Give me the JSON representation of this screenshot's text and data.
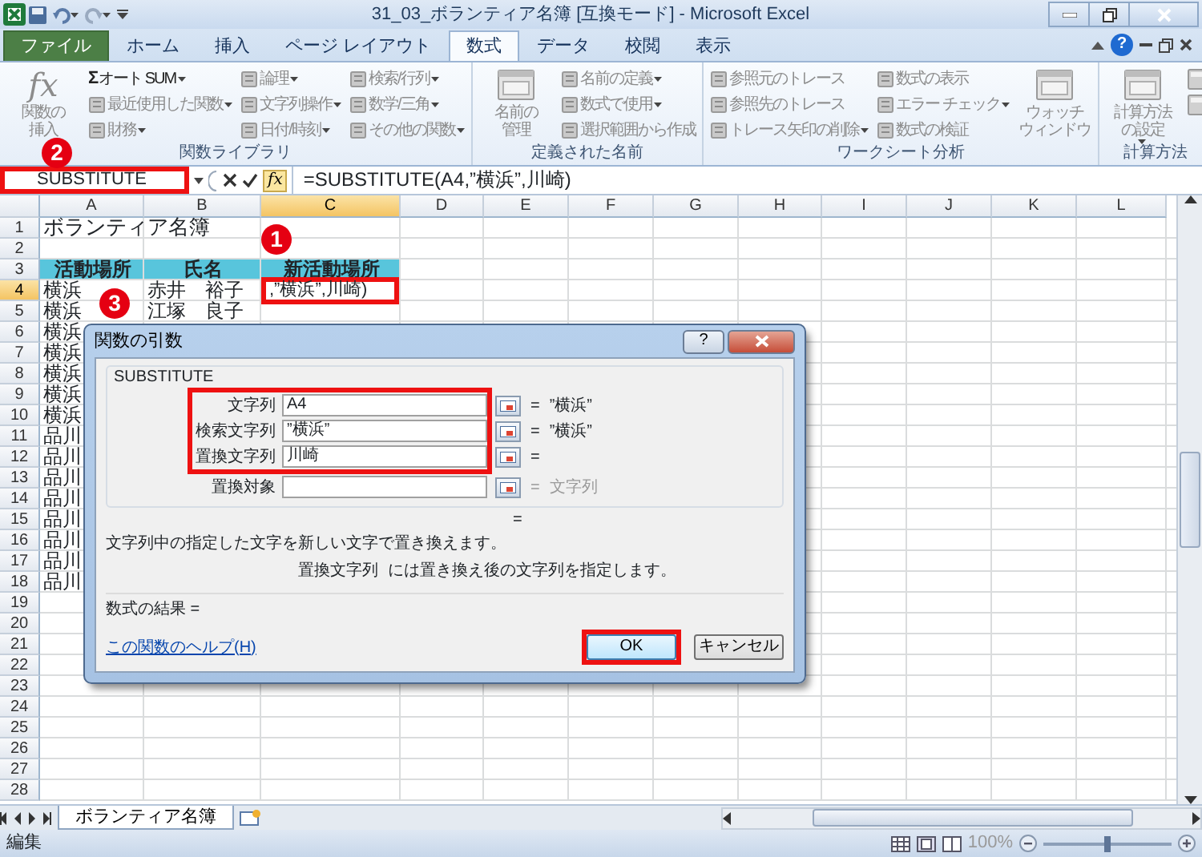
{
  "title_bar": {
    "title": "31_03_ボランティア名簿 [互換モード] - Microsoft Excel"
  },
  "ribbon_tabs": [
    {
      "label": "ファイル",
      "kind": "file",
      "selected": false
    },
    {
      "label": "ホーム",
      "kind": "tab",
      "selected": false
    },
    {
      "label": "挿入",
      "kind": "tab",
      "selected": false
    },
    {
      "label": "ページ レイアウト",
      "kind": "tab",
      "selected": false
    },
    {
      "label": "数式",
      "kind": "tab",
      "selected": true
    },
    {
      "label": "データ",
      "kind": "tab",
      "selected": false
    },
    {
      "label": "校閲",
      "kind": "tab",
      "selected": false
    },
    {
      "label": "表示",
      "kind": "tab",
      "selected": false
    }
  ],
  "ribbon_help": "?",
  "ribbon_groups": [
    {
      "label": "関数ライブラリ",
      "items": [
        {
          "kind": "large",
          "lines": [
            "関数の",
            "挿入"
          ],
          "glyph": "fx",
          "disabled": true
        },
        {
          "kind": "small",
          "label": "オート SUM",
          "glyph": "Σ",
          "dropdown": true,
          "disabled": false
        },
        {
          "kind": "small",
          "label": "最近使用した関数",
          "dropdown": true,
          "disabled": true
        },
        {
          "kind": "small",
          "label": "財務",
          "dropdown": true,
          "disabled": true
        },
        {
          "kind": "small",
          "label": "論理",
          "dropdown": true,
          "disabled": true
        },
        {
          "kind": "small",
          "label": "文字列操作",
          "dropdown": true,
          "disabled": true
        },
        {
          "kind": "small",
          "label": "日付/時刻",
          "dropdown": true,
          "disabled": true
        },
        {
          "kind": "small",
          "label": "検索/行列",
          "dropdown": true,
          "disabled": true
        },
        {
          "kind": "small",
          "label": "数学/三角",
          "dropdown": true,
          "disabled": true
        },
        {
          "kind": "small",
          "label": "その他の関数",
          "dropdown": true,
          "disabled": true
        }
      ]
    },
    {
      "label": "定義された名前",
      "items": [
        {
          "kind": "large",
          "lines": [
            "名前の",
            "管理"
          ],
          "disabled": true
        },
        {
          "kind": "small",
          "label": "名前の定義",
          "dropdown": true,
          "disabled": true
        },
        {
          "kind": "small",
          "label": "数式で使用",
          "dropdown": true,
          "disabled": true
        },
        {
          "kind": "small",
          "label": "選択範囲から作成",
          "dropdown": false,
          "disabled": true
        }
      ]
    },
    {
      "label": "ワークシート分析",
      "items": [
        {
          "kind": "small",
          "label": "参照元のトレース",
          "dropdown": false,
          "disabled": true
        },
        {
          "kind": "small",
          "label": "参照先のトレース",
          "dropdown": false,
          "disabled": true
        },
        {
          "kind": "small",
          "label": "トレース矢印の削除",
          "dropdown": true,
          "disabled": true
        },
        {
          "kind": "small",
          "label": "数式の表示",
          "dropdown": false,
          "disabled": true
        },
        {
          "kind": "small",
          "label": "エラー チェック",
          "dropdown": true,
          "disabled": true
        },
        {
          "kind": "small",
          "label": "数式の検証",
          "dropdown": false,
          "disabled": true
        },
        {
          "kind": "large",
          "lines": [
            "ウォッチ",
            "ウィンドウ"
          ],
          "disabled": true
        }
      ]
    },
    {
      "label": "計算方法",
      "items": [
        {
          "kind": "large",
          "lines": [
            "計算方法",
            "の設定"
          ],
          "dropdown": true,
          "disabled": true
        },
        {
          "kind": "icon",
          "disabled": true
        },
        {
          "kind": "icon",
          "disabled": true
        }
      ]
    }
  ],
  "formula_bar": {
    "name_box": "SUBSTITUTE",
    "name_box_highlighted": true,
    "fx": "fx",
    "formula": "=SUBSTITUTE(A4,”横浜”,川崎)"
  },
  "columns": [
    {
      "label": "A",
      "selected": false
    },
    {
      "label": "B",
      "selected": false
    },
    {
      "label": "C",
      "selected": true
    },
    {
      "label": "D",
      "selected": false
    },
    {
      "label": "E",
      "selected": false
    },
    {
      "label": "F",
      "selected": false
    },
    {
      "label": "G",
      "selected": false
    },
    {
      "label": "H",
      "selected": false
    },
    {
      "label": "I",
      "selected": false
    },
    {
      "label": "J",
      "selected": false
    },
    {
      "label": "K",
      "selected": false
    },
    {
      "label": "L",
      "selected": false
    }
  ],
  "rows": [
    {
      "number": "1",
      "selected": false,
      "cells": [
        {
          "kind": "title",
          "text": "ボランティア名簿"
        }
      ]
    },
    {
      "number": "2",
      "selected": false
    },
    {
      "number": "3",
      "selected": false,
      "cells": [
        {
          "kind": "header",
          "text": "活動場所"
        },
        {
          "kind": "header",
          "text": "氏名"
        },
        {
          "kind": "header",
          "text": "新活動場所"
        }
      ]
    },
    {
      "number": "4",
      "selected": true,
      "cells": [
        {
          "kind": "plain",
          "text": "横浜"
        },
        {
          "kind": "plain",
          "text": "赤井　裕子"
        },
        {
          "kind": "editing",
          "text": ",”横浜”,川崎)",
          "highlighted": true
        }
      ]
    },
    {
      "number": "5",
      "selected": false,
      "cells": [
        {
          "kind": "plain",
          "text": "横浜"
        },
        {
          "kind": "plain",
          "text": "江塚　良子"
        }
      ]
    },
    {
      "number": "6",
      "selected": false,
      "cells": [
        {
          "kind": "plain",
          "text": "横浜"
        }
      ]
    },
    {
      "number": "7",
      "selected": false,
      "cells": [
        {
          "kind": "plain",
          "text": "横浜"
        }
      ]
    },
    {
      "number": "8",
      "selected": false,
      "cells": [
        {
          "kind": "plain",
          "text": "横浜"
        }
      ]
    },
    {
      "number": "9",
      "selected": false,
      "cells": [
        {
          "kind": "plain",
          "text": "横浜"
        }
      ]
    },
    {
      "number": "10",
      "selected": false,
      "cells": [
        {
          "kind": "plain",
          "text": "横浜"
        }
      ]
    },
    {
      "number": "11",
      "selected": false,
      "cells": [
        {
          "kind": "plain",
          "text": "品川"
        }
      ]
    },
    {
      "number": "12",
      "selected": false,
      "cells": [
        {
          "kind": "plain",
          "text": "品川"
        }
      ]
    },
    {
      "number": "13",
      "selected": false,
      "cells": [
        {
          "kind": "plain",
          "text": "品川"
        }
      ]
    },
    {
      "number": "14",
      "selected": false,
      "cells": [
        {
          "kind": "plain",
          "text": "品川"
        }
      ]
    },
    {
      "number": "15",
      "selected": false,
      "cells": [
        {
          "kind": "plain",
          "text": "品川"
        }
      ]
    },
    {
      "number": "16",
      "selected": false,
      "cells": [
        {
          "kind": "plain",
          "text": "品川"
        }
      ]
    },
    {
      "number": "17",
      "selected": false,
      "cells": [
        {
          "kind": "plain",
          "text": "品川"
        }
      ]
    },
    {
      "number": "18",
      "selected": false,
      "cells": [
        {
          "kind": "plain",
          "text": "品川"
        }
      ]
    },
    {
      "number": "19",
      "selected": false
    },
    {
      "number": "20",
      "selected": false
    },
    {
      "number": "21",
      "selected": false
    },
    {
      "number": "22",
      "selected": false
    },
    {
      "number": "23",
      "selected": false
    },
    {
      "number": "24",
      "selected": false
    },
    {
      "number": "25",
      "selected": false
    },
    {
      "number": "26",
      "selected": false
    },
    {
      "number": "27",
      "selected": false
    },
    {
      "number": "28",
      "selected": false
    }
  ],
  "dialog": {
    "title": "関数の引数",
    "help": "?",
    "function_name": "SUBSTITUTE",
    "arguments": [
      {
        "label": "文字列",
        "value": "A4",
        "equals": "=",
        "result": "”横浜”",
        "muted": false,
        "highlighted": true
      },
      {
        "label": "検索文字列",
        "value": "”横浜”",
        "equals": "=",
        "result": "”横浜”",
        "muted": false,
        "highlighted": true
      },
      {
        "label": "置換文字列",
        "value": "川崎",
        "equals": "=",
        "muted": false,
        "highlighted": true
      },
      {
        "label": "置換対象",
        "equals": "=",
        "result": "文字列",
        "muted": true,
        "highlighted": false
      }
    ],
    "overall_equals": "=",
    "description": "文字列中の指定した文字を新しい文字で置き換えます。",
    "argument_help_name": "置換文字列",
    "argument_help": "には置き換え後の文字列を指定します。",
    "result_label": "数式の結果 =",
    "help_link": "この関数のヘルプ(H)",
    "buttons": [
      {
        "label": "OK",
        "highlighted": true
      },
      {
        "label": "キャンセル",
        "highlighted": false
      }
    ]
  },
  "sheet_tabs": [
    {
      "label": "ボランティア名簿",
      "selected": true
    }
  ],
  "status_bar": {
    "mode": "編集",
    "zoom": "100%",
    "zoom_slider": {
      "level": 0.5
    }
  },
  "callouts": [
    {
      "text": "1"
    },
    {
      "text": "2"
    },
    {
      "text": "3"
    }
  ]
}
